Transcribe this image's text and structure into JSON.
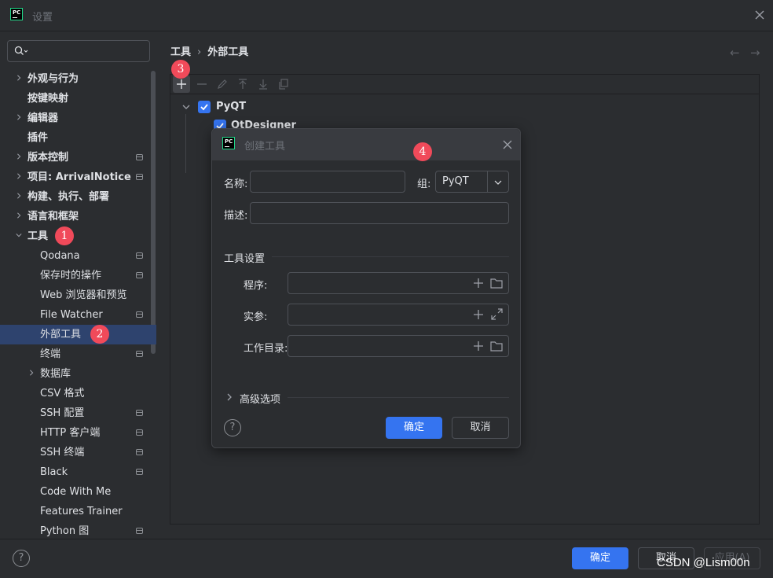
{
  "window": {
    "title": "设置"
  },
  "sidebar": {
    "search_placeholder": "",
    "items": [
      {
        "label": "外观与行为",
        "expandable": true,
        "bold": true
      },
      {
        "label": "按键映射",
        "expandable": false,
        "bold": true
      },
      {
        "label": "编辑器",
        "expandable": true,
        "bold": true
      },
      {
        "label": "插件",
        "expandable": false,
        "bold": true
      },
      {
        "label": "版本控制",
        "expandable": true,
        "bold": true
      },
      {
        "label": "项目: ArrivalNotice",
        "expandable": true,
        "bold": true
      },
      {
        "label": "构建、执行、部署",
        "expandable": true,
        "bold": true
      },
      {
        "label": "语言和框架",
        "expandable": true,
        "bold": true
      },
      {
        "label": "工具",
        "expandable": true,
        "bold": true
      },
      {
        "label": "Qodana"
      },
      {
        "label": "保存时的操作"
      },
      {
        "label": "Web 浏览器和预览"
      },
      {
        "label": "File Watcher"
      },
      {
        "label": "外部工具"
      },
      {
        "label": "终端"
      },
      {
        "label": "数据库"
      },
      {
        "label": "CSV 格式"
      },
      {
        "label": "SSH 配置"
      },
      {
        "label": "HTTP 客户端"
      },
      {
        "label": "SSH 终端"
      },
      {
        "label": "Black"
      },
      {
        "label": "Code With Me"
      },
      {
        "label": "Features Trainer"
      },
      {
        "label": "Python 图"
      }
    ]
  },
  "badges": [
    "1",
    "2",
    "3",
    "4"
  ],
  "breadcrumb": {
    "parent": "工具",
    "separator": "›",
    "current": "外部工具"
  },
  "nav": {
    "back": "←",
    "forward": "→"
  },
  "tree": {
    "group": "PyQT",
    "child": "QtDesigner"
  },
  "dialog": {
    "title": "创建工具",
    "name_label": "名称:",
    "name_value": "",
    "group_label": "组:",
    "group_value": "PyQT",
    "desc_label": "描述:",
    "desc_value": "",
    "section_tool_settings": "工具设置",
    "program_label": "程序:",
    "args_label": "实参:",
    "workdir_label": "工作目录:",
    "advanced_label": "高级选项",
    "ok_label": "确定",
    "cancel_label": "取消",
    "help_label": "?"
  },
  "footer": {
    "help_label": "?",
    "ok_label": "确定",
    "cancel_label": "取消",
    "apply_label": "应用(A)"
  },
  "watermark": "CSDN @Lism00n",
  "colors": {
    "accent": "#3574f0",
    "badge": "#f04a5a",
    "selected": "#2e436e",
    "background": "#2b2d30"
  }
}
